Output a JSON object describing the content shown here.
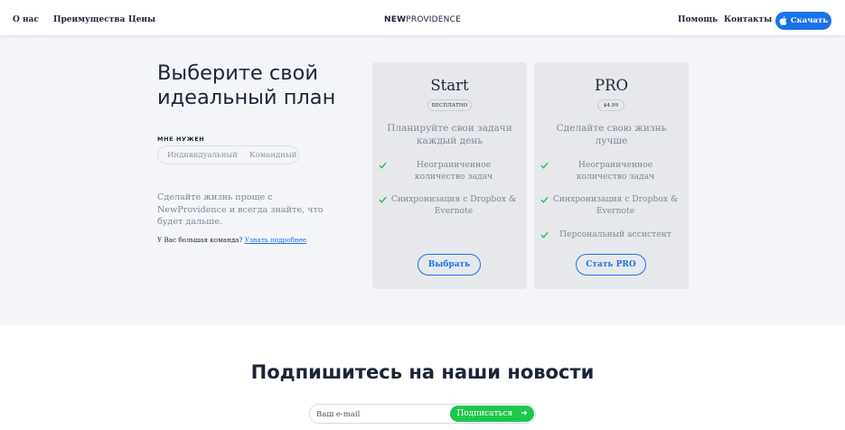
{
  "header": {
    "nav_left": [
      "О нас",
      "Преимущества",
      "Цены"
    ],
    "logo_bold": "NEW",
    "logo_rest": "PROVIDENCE",
    "nav_right": [
      "Помощь",
      "Контакты"
    ],
    "download_label": "Скачать",
    "download_icon": "apple-icon"
  },
  "pricing": {
    "headline_line1": "Выберите свой",
    "headline_line2": "идеальный план",
    "need_label": "МНЕ НУЖЕН",
    "toggle_options": [
      "Индивидуальный",
      "Командный"
    ],
    "description": "Сделайте жизнь проще с NewProvidence и всегда знайте, что будет дальше.",
    "team_question": "У Вас большая команда?",
    "team_link": "Узнать подробнее"
  },
  "plans": [
    {
      "title": "Start",
      "badge": "БЕСПЛАТНО",
      "subtitle": "Планируйте свои задачи каждый день",
      "features": [
        "Неограниченное количество задач",
        "Синхронизация с Dropbox & Evernote"
      ],
      "button": "Выбрать"
    },
    {
      "title": "PRO",
      "badge": "$4.99",
      "subtitle": "Сделайте свою жизнь лучше",
      "features": [
        "Неограниченное количество задач",
        "Синхронизация с Dropbox & Evernote",
        "Персональный ассистент"
      ],
      "button": "Стать PRO"
    }
  ],
  "newsletter": {
    "title": "Подпишитесь на наши новости",
    "email_placeholder": "Ваш e-mail",
    "subscribe_label": "Подписаться",
    "arrow_icon": "arrow-right-icon"
  },
  "colors": {
    "accent_blue": "#1a73e8",
    "accent_green": "#1ec64b",
    "check_green": "#1ec64b",
    "section_gray": "#f4f5f8",
    "card_gray": "#e7e8ec"
  }
}
